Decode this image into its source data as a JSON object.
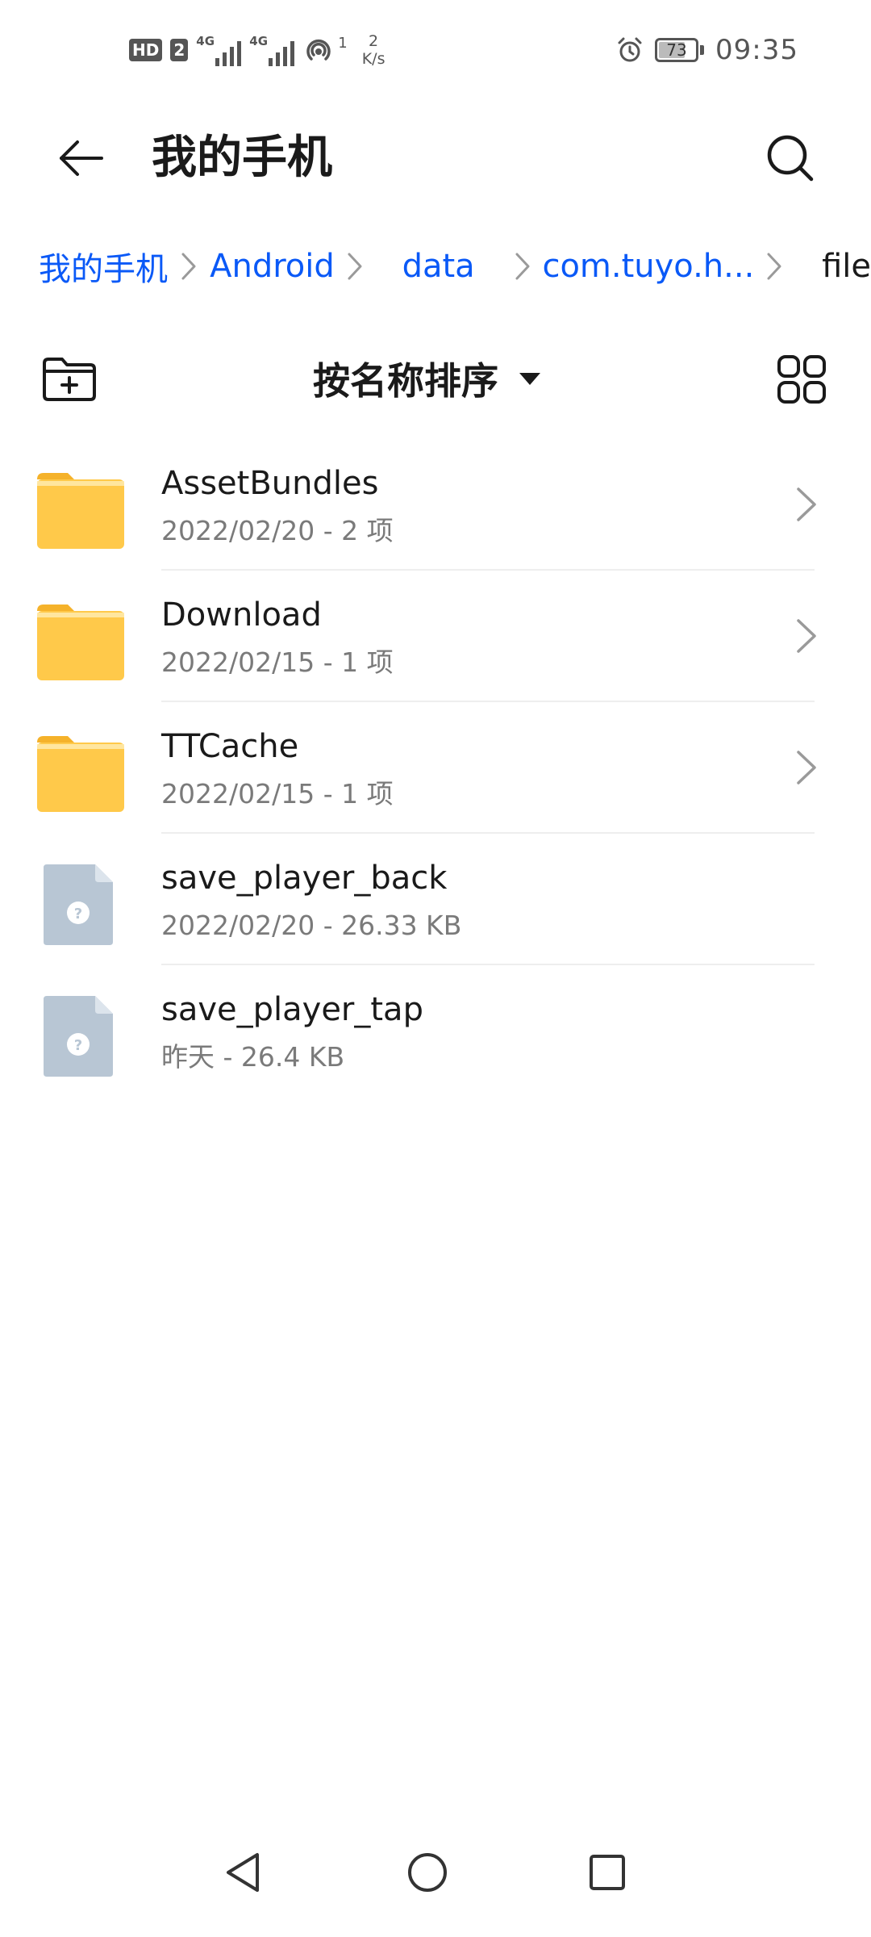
{
  "status_bar": {
    "hd_label": "HD",
    "sim_label": "2",
    "net1_label": "4G",
    "net2_label": "4G",
    "hotspot_count": "1",
    "speed_value": "2",
    "speed_unit": "K/s",
    "battery_level": "73",
    "battery_fraction": 0.73,
    "time": "09:35"
  },
  "header": {
    "title": "我的手机"
  },
  "breadcrumb": {
    "items": [
      {
        "label": "我的手机"
      },
      {
        "label": "Android"
      },
      {
        "label": "data"
      },
      {
        "label": "com.tuyo.h..."
      },
      {
        "label": "file"
      }
    ]
  },
  "toolbar": {
    "sort_label": "按名称排序"
  },
  "files": [
    {
      "name": "AssetBundles",
      "meta": "2022/02/20 - 2 项",
      "type": "folder"
    },
    {
      "name": "Download",
      "meta": "2022/02/15 - 1 项",
      "type": "folder"
    },
    {
      "name": "TTCache",
      "meta": "2022/02/15 - 1 项",
      "type": "folder"
    },
    {
      "name": "save_player_back",
      "meta": "2022/02/20 - 26.33 KB",
      "type": "unknown-file"
    },
    {
      "name": "save_player_tap",
      "meta": "昨天 - 26.4 KB",
      "type": "unknown-file"
    }
  ],
  "colors": {
    "accent": "#0a59f7",
    "folder": "#ffc94a",
    "folder_tab": "#f5b22a",
    "unknown_file": "#b8c6d4"
  }
}
